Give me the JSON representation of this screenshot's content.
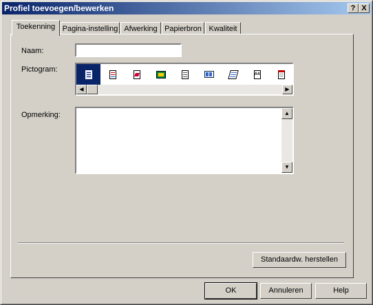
{
  "window": {
    "title": "Profiel toevoegen/bewerken",
    "help_glyph": "?",
    "close_glyph": "X"
  },
  "tabs": [
    {
      "label": "Toekenning",
      "active": true
    },
    {
      "label": "Pagina-instelling"
    },
    {
      "label": "Afwerking"
    },
    {
      "label": "Papierbron"
    },
    {
      "label": "Kwaliteit"
    }
  ],
  "form": {
    "name_label": "Naam:",
    "name_value": "",
    "icon_label": "Pictogram:",
    "icons": [
      "profile-default-icon",
      "profile-text-icon",
      "profile-color-icon",
      "profile-image-icon",
      "profile-booklet-icon",
      "profile-nup-icon",
      "profile-poster-icon",
      "profile-a4-icon",
      "profile-calendar-icon"
    ],
    "a4_text": "A4",
    "comment_label": "Opmerking:",
    "comment_value": "",
    "restore_button": "Standaardw. herstellen"
  },
  "buttons": {
    "ok": "OK",
    "cancel": "Annuleren",
    "help": "Help"
  },
  "colors": {
    "titlebar_start": "#0a246a",
    "selected": "#0a246a",
    "face": "#d4d0c8"
  }
}
